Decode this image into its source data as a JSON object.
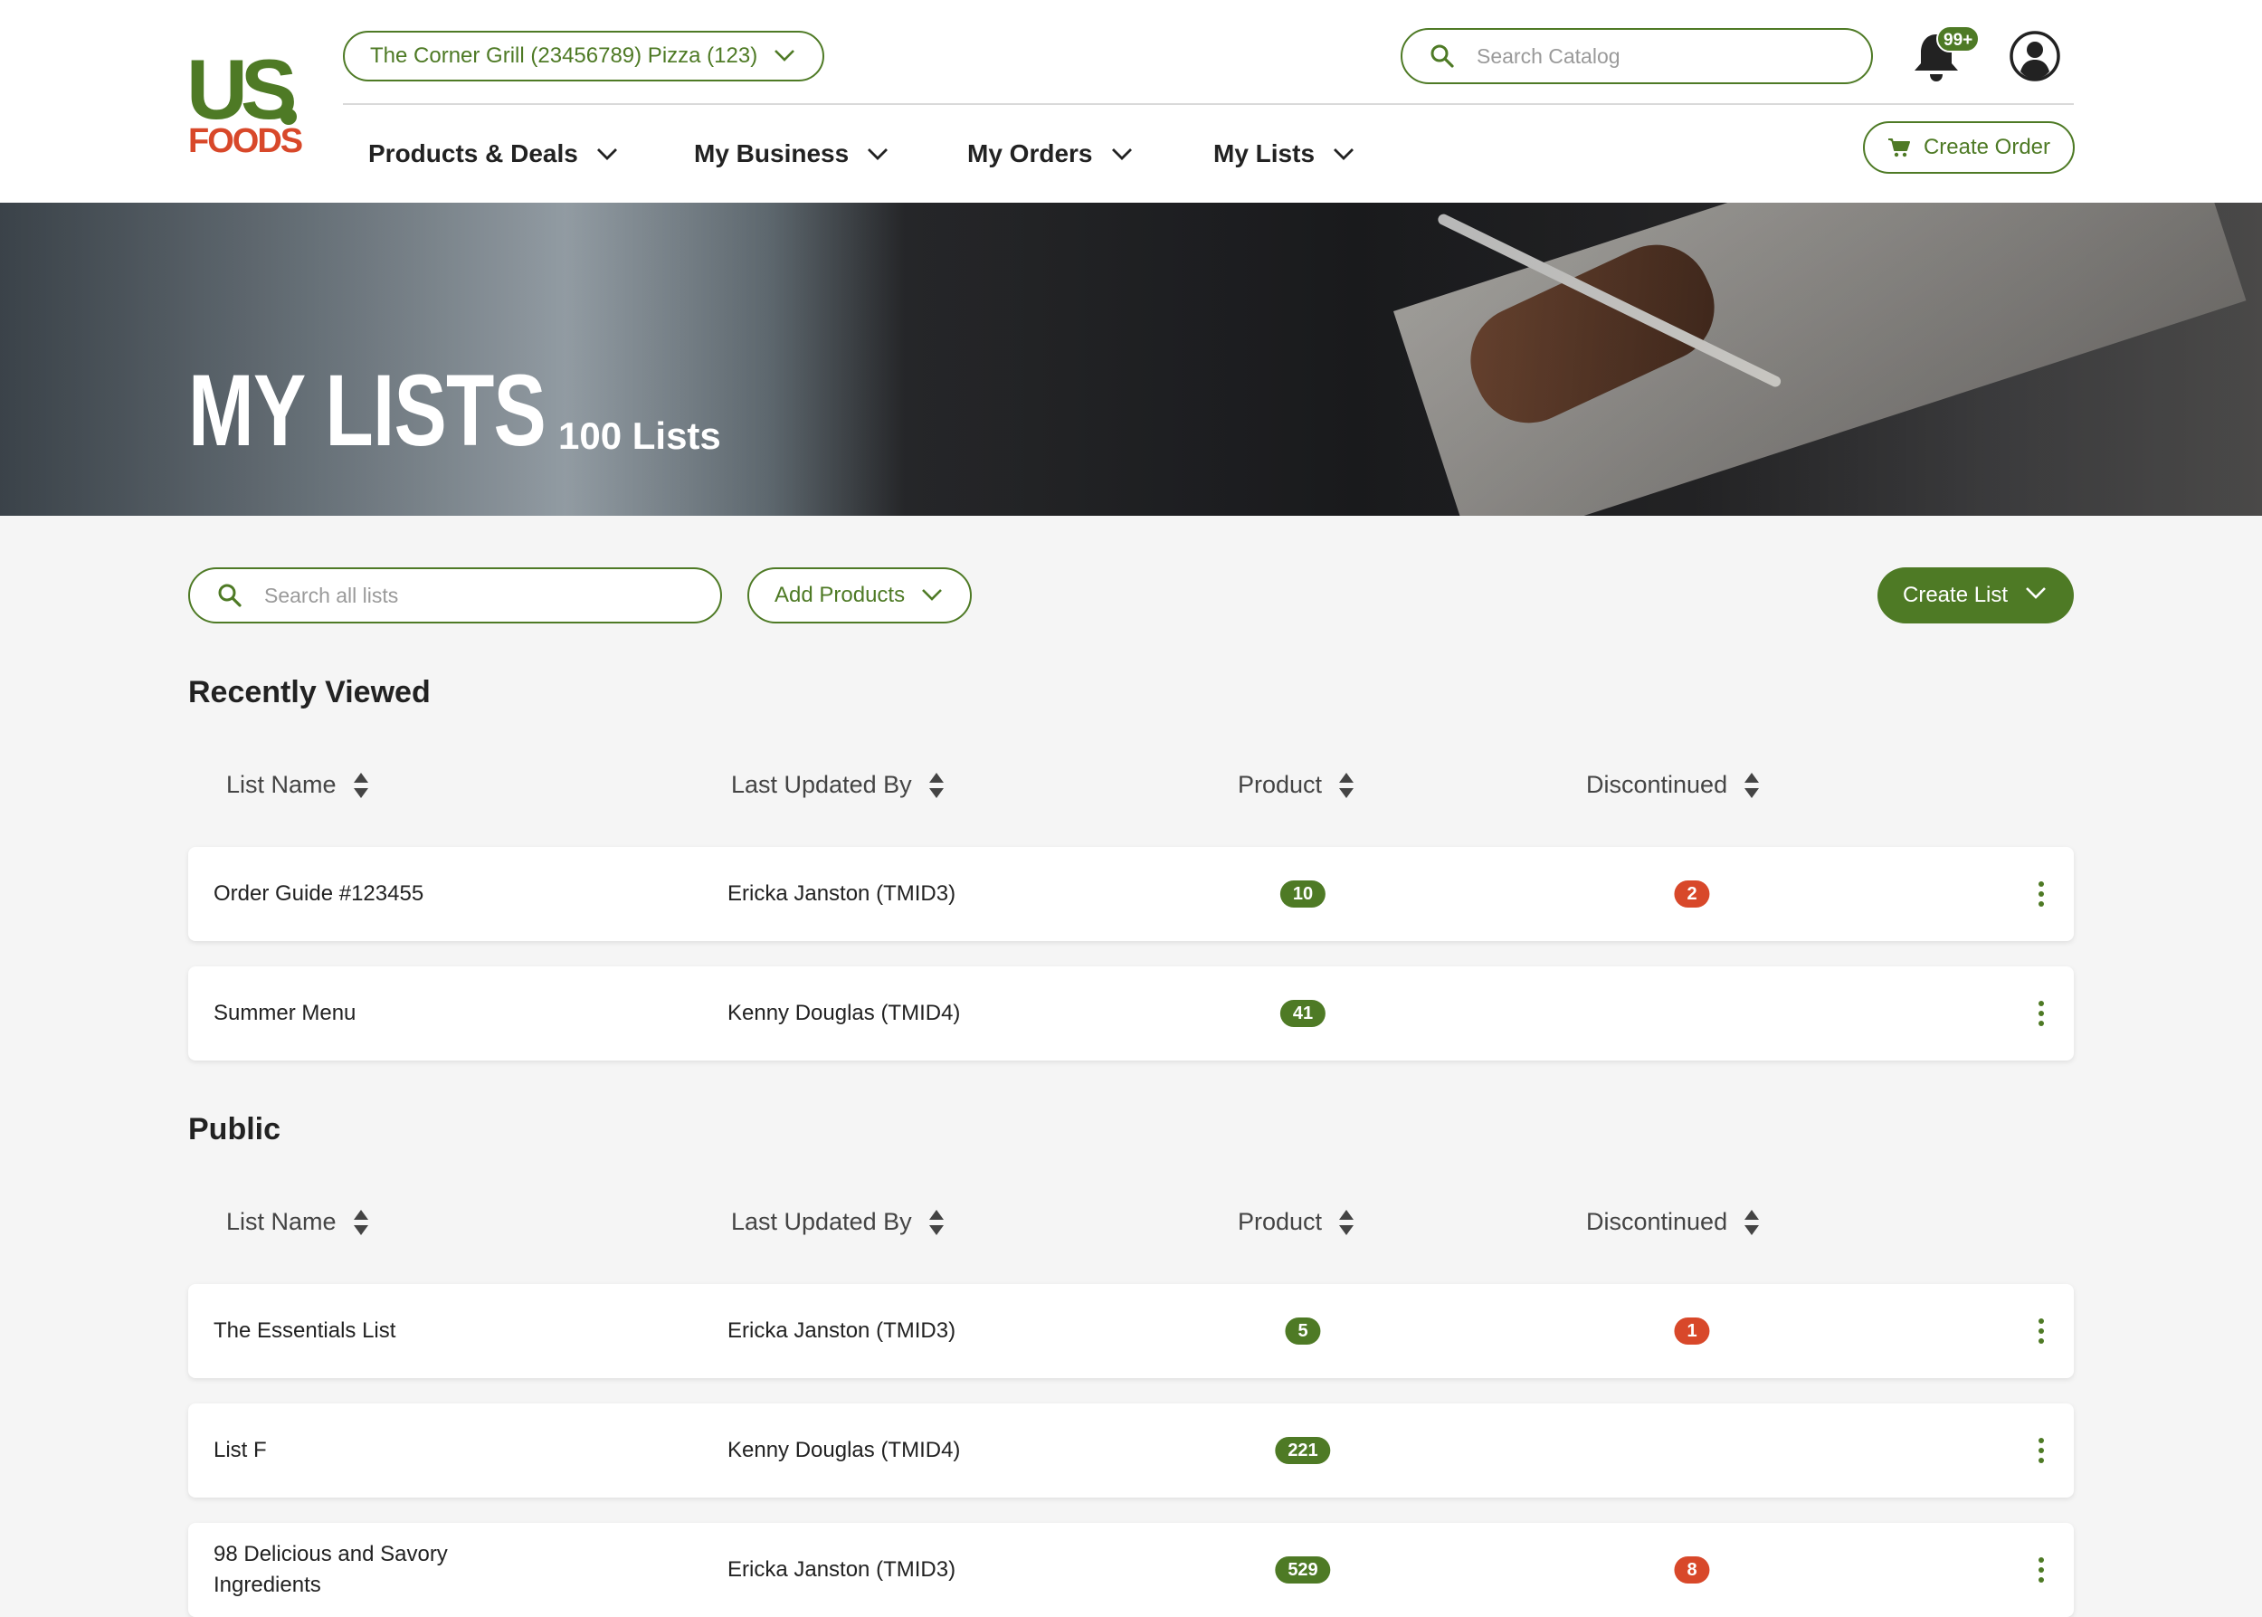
{
  "brand": {
    "logo_top": "US",
    "logo_bottom": "FOODS"
  },
  "header": {
    "location": "The Corner Grill (23456789) Pizza (123)",
    "search_placeholder": "Search Catalog",
    "notification_count": "99+",
    "create_order_label": "Create Order"
  },
  "nav": {
    "items": [
      {
        "label": "Products & Deals"
      },
      {
        "label": "My Business"
      },
      {
        "label": "My Orders"
      },
      {
        "label": "My Lists"
      }
    ]
  },
  "hero": {
    "title": "MY LISTS",
    "count": "100 Lists"
  },
  "toolbar": {
    "search_placeholder": "Search all lists",
    "add_products_label": "Add Products",
    "create_list_label": "Create List"
  },
  "columns": {
    "list_name": "List Name",
    "last_updated_by": "Last Updated By",
    "product": "Product",
    "discontinued": "Discontinued"
  },
  "sections": [
    {
      "title": "Recently Viewed",
      "rows": [
        {
          "name": "Order Guide #123455",
          "updated_by": "Ericka Janston (TMID3)",
          "product": "10",
          "discontinued": "2"
        },
        {
          "name": "Summer Menu",
          "updated_by": "Kenny Douglas (TMID4)",
          "product": "41",
          "discontinued": ""
        }
      ]
    },
    {
      "title": "Public",
      "rows": [
        {
          "name": "The Essentials List",
          "updated_by": "Ericka Janston (TMID3)",
          "product": "5",
          "discontinued": "1"
        },
        {
          "name": "List F",
          "updated_by": "Kenny Douglas (TMID4)",
          "product": "221",
          "discontinued": ""
        },
        {
          "name": "98 Delicious and Savory Ingredients",
          "updated_by": "Ericka Janston (TMID3)",
          "product": "529",
          "discontinued": "8"
        }
      ]
    }
  ],
  "colors": {
    "brand_green": "#4e7a25",
    "alert_red": "#d8482a",
    "page_bg": "#f5f5f5"
  },
  "icons": {
    "search": "search-icon",
    "bell": "bell-icon",
    "user": "user-icon",
    "cart": "cart-icon",
    "sort": "sort-icon",
    "kebab": "kebab-icon",
    "chevron": "chevron-down-icon"
  }
}
